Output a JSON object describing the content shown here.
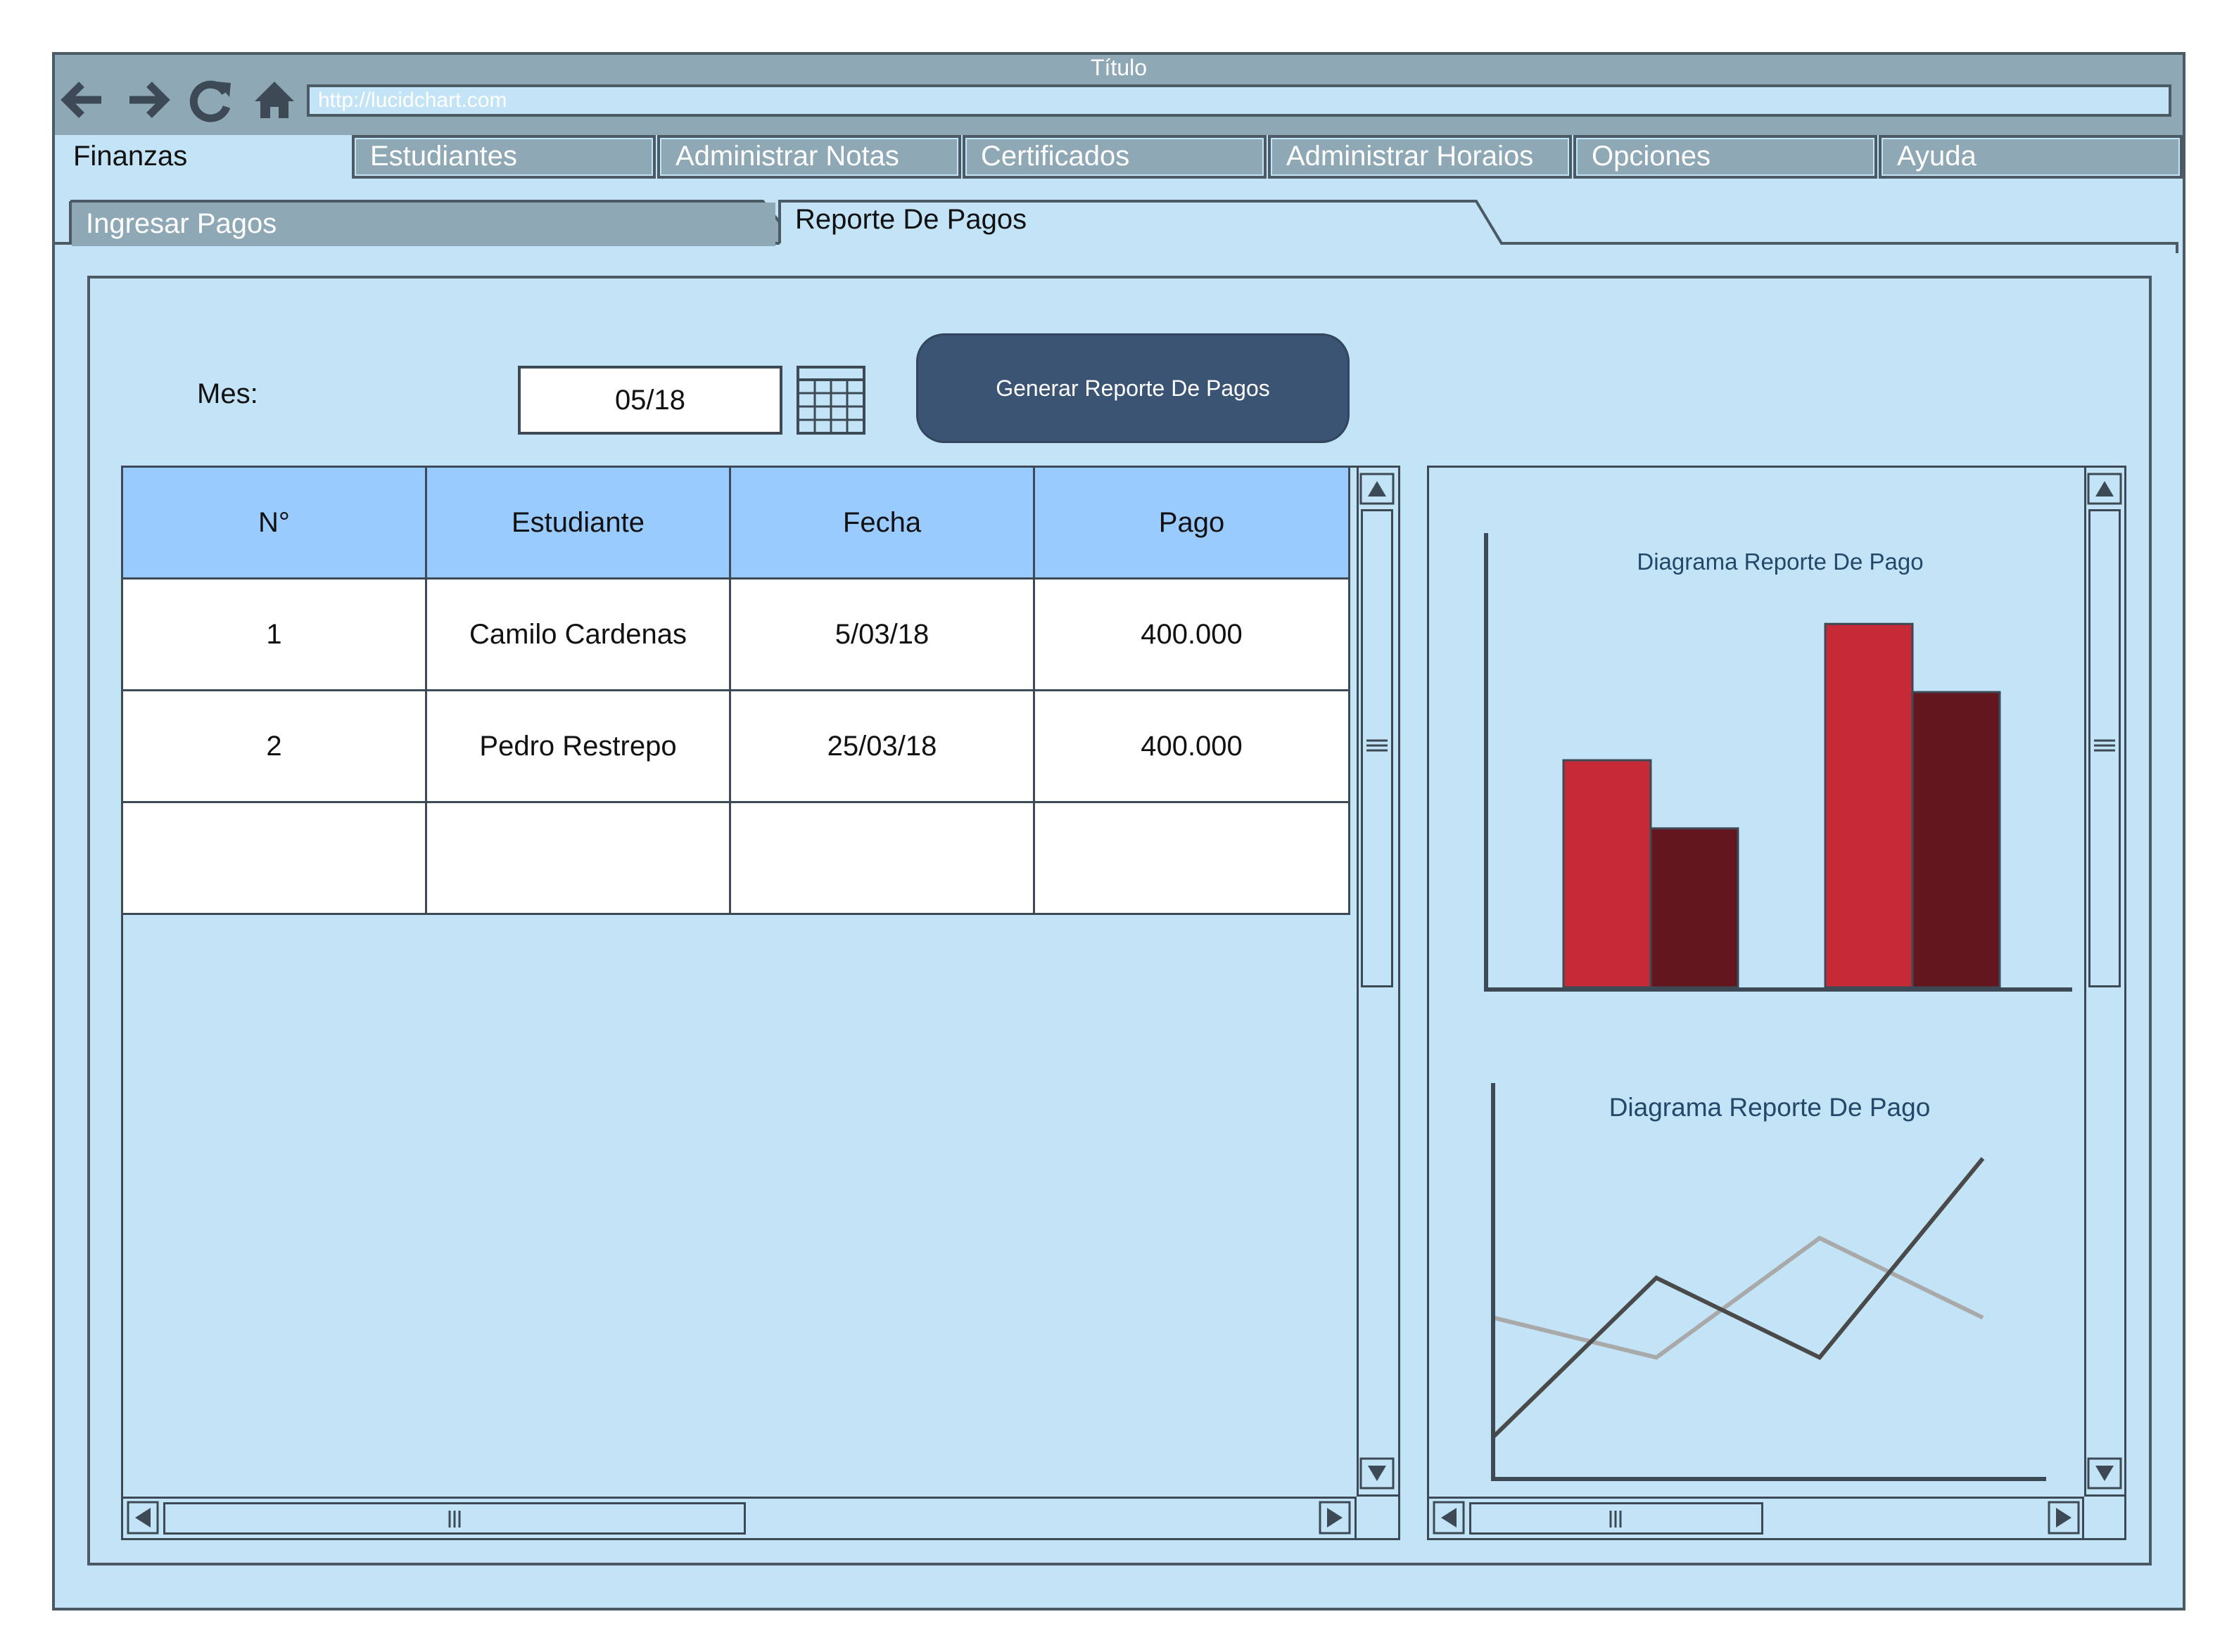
{
  "window": {
    "title": "Título",
    "url": "http://lucidchart.com"
  },
  "nav_icons": [
    "back-arrow-icon",
    "forward-arrow-icon",
    "refresh-icon",
    "home-icon"
  ],
  "menu": [
    {
      "label": "Finanzas",
      "active": true
    },
    {
      "label": "Estudiantes",
      "active": false
    },
    {
      "label": "Administrar Notas",
      "active": false
    },
    {
      "label": "Certificados",
      "active": false
    },
    {
      "label": "Administrar Horaios",
      "active": false
    },
    {
      "label": "Opciones",
      "active": false
    },
    {
      "label": "Ayuda",
      "active": false
    }
  ],
  "subtabs": [
    {
      "label": "Ingresar Pagos",
      "active": false
    },
    {
      "label": "Reporte De Pagos",
      "active": true
    }
  ],
  "form": {
    "month_label": "Mes:",
    "month_value": "05/18",
    "generate_button": "Generar Reporte De Pagos"
  },
  "table": {
    "headers": [
      "N°",
      "Estudiante",
      "Fecha",
      "Pago"
    ],
    "rows": [
      [
        "1",
        "Camilo Cardenas",
        "5/03/18",
        "400.000"
      ],
      [
        "2",
        "Pedro Restrepo",
        "25/03/18",
        "400.000"
      ],
      [
        "",
        "",
        "",
        ""
      ]
    ]
  },
  "colors": {
    "window_bg": "#c2e4f6",
    "titlebar": "#8ea9b5",
    "header_row": "#99cbff",
    "button": "#3c5474",
    "bar_series_1": "#c72a37",
    "bar_series_2": "#63161e",
    "line_series_1": "#4a4a4a",
    "line_series_2": "#a9a9a9"
  },
  "chart_data": [
    {
      "type": "bar",
      "title": "Diagrama Reporte De Pago",
      "categories": [
        "",
        ""
      ],
      "series": [
        {
          "values": [
            50,
            80
          ]
        },
        {
          "values": [
            35,
            65
          ]
        }
      ],
      "ylim": [
        0,
        100
      ],
      "grid": false
    },
    {
      "type": "line",
      "title": "Diagrama Reporte De Pago",
      "x": [
        0,
        1,
        2,
        3
      ],
      "series": [
        {
          "values": [
            10,
            50,
            30,
            80
          ]
        },
        {
          "values": [
            40,
            30,
            60,
            40
          ]
        }
      ],
      "ylim": [
        0,
        100
      ],
      "grid": false
    }
  ]
}
